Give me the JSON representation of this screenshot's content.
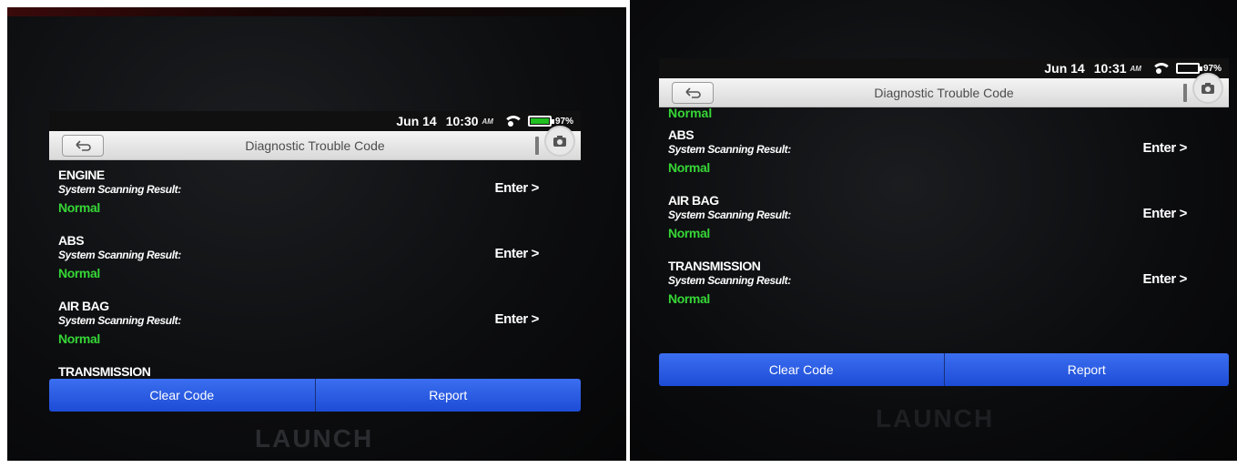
{
  "left_photo": {
    "status_bar": {
      "date": "Jun 14",
      "time": "10:30",
      "ampm": "AM",
      "battery": "97%",
      "battery_color": "#20c020"
    },
    "title": "Diagnostic Trouble Code",
    "items": [
      {
        "name": "ENGINE",
        "label": "System Scanning Result:",
        "status": "Normal",
        "action": "Enter >"
      },
      {
        "name": "ABS",
        "label": "System Scanning Result:",
        "status": "Normal",
        "action": "Enter >"
      },
      {
        "name": "AIR BAG",
        "label": "System Scanning Result:",
        "status": "Normal",
        "action": "Enter >"
      },
      {
        "name": "TRANSMISSION"
      }
    ],
    "buttons": {
      "clear": "Clear Code",
      "report": "Report"
    },
    "brand": "LAUNCH"
  },
  "right_photo": {
    "status_bar": {
      "date": "Jun 14",
      "time": "10:31",
      "ampm": "AM",
      "battery": "97%"
    },
    "title": "Diagnostic Trouble Code",
    "partial_status": "Normal",
    "items": [
      {
        "name": "ABS",
        "label": "System Scanning Result:",
        "status": "Normal",
        "action": "Enter >"
      },
      {
        "name": "AIR BAG",
        "label": "System Scanning Result:",
        "status": "Normal",
        "action": "Enter >"
      },
      {
        "name": "TRANSMISSION",
        "label": "System Scanning Result:",
        "status": "Normal",
        "action": "Enter >"
      }
    ],
    "buttons": {
      "clear": "Clear Code",
      "report": "Report"
    },
    "brand": "LAUNCH"
  },
  "colors": {
    "normal_green": "#36d636",
    "button_blue": "#2f62e8"
  }
}
